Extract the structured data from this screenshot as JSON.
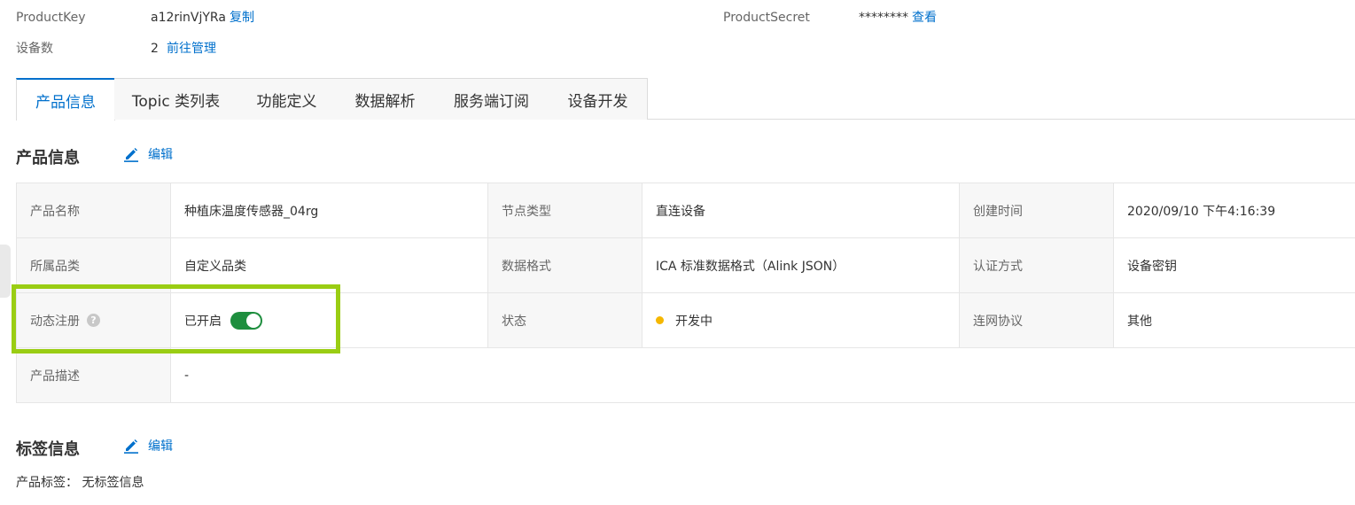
{
  "header": {
    "product_key_label": "ProductKey",
    "product_key_value": "a12rinVjYRa",
    "copy_label": "复制",
    "product_secret_label": "ProductSecret",
    "product_secret_value": "********",
    "view_label": "查看",
    "device_count_label": "设备数",
    "device_count_value": "2",
    "manage_label": "前往管理"
  },
  "tabs": [
    {
      "label": "产品信息",
      "active": true
    },
    {
      "label": "Topic 类列表",
      "active": false
    },
    {
      "label": "功能定义",
      "active": false
    },
    {
      "label": "数据解析",
      "active": false
    },
    {
      "label": "服务端订阅",
      "active": false
    },
    {
      "label": "设备开发",
      "active": false
    }
  ],
  "product_info": {
    "title": "产品信息",
    "edit_label": "编辑",
    "rows": [
      [
        {
          "label": "产品名称",
          "value": "种植床温度传感器_04rg"
        },
        {
          "label": "节点类型",
          "value": "直连设备"
        },
        {
          "label": "创建时间",
          "value": "2020/09/10 下午4:16:39"
        }
      ],
      [
        {
          "label": "所属品类",
          "value": "自定义品类"
        },
        {
          "label": "数据格式",
          "value": "ICA 标准数据格式（Alink JSON）"
        },
        {
          "label": "认证方式",
          "value": "设备密钥"
        }
      ],
      [
        {
          "label": "动态注册",
          "value": "已开启",
          "toggle": true,
          "help": true
        },
        {
          "label": "状态",
          "value": "开发中",
          "status_dot": true
        },
        {
          "label": "连网协议",
          "value": "其他"
        }
      ]
    ],
    "description_label": "产品描述",
    "description_value": "-",
    "help_glyph": "?"
  },
  "tag_info": {
    "title": "标签信息",
    "edit_label": "编辑",
    "product_tag_label": "产品标签：",
    "product_tag_value": "无标签信息"
  },
  "colors": {
    "accent": "#0070cc",
    "toggle_on": "#1e8e3e",
    "status_developing": "#f5b700",
    "highlight": "#9acd13"
  },
  "icons": {
    "edit": "pencil-icon",
    "help": "question-circle-icon",
    "status": "status-dot-icon"
  }
}
